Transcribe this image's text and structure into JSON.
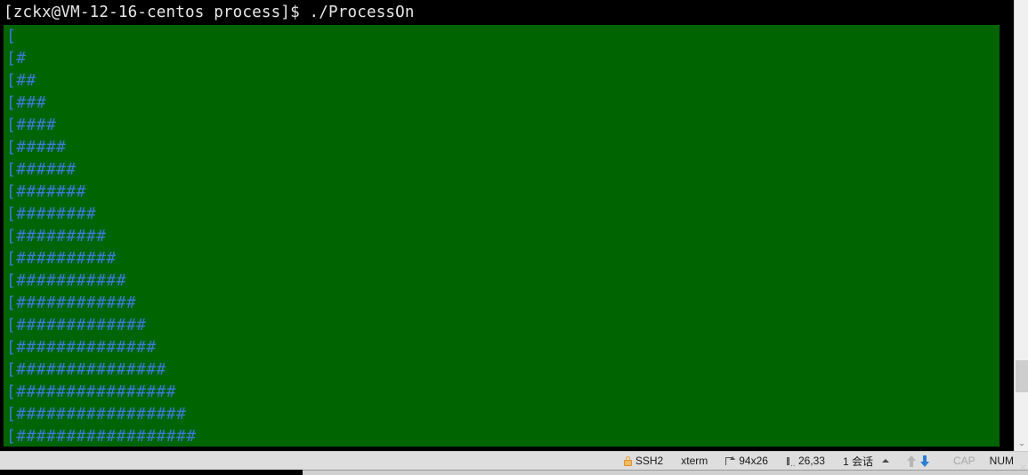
{
  "terminal": {
    "prompt_line": "[zckx@VM-12-16-centos process]$ ./ProcessOn",
    "background_color": "#006400",
    "text_color": "#3b7ad9",
    "prompt_background": "#000000",
    "prompt_text_color": "#e8e8e8",
    "output_lines": [
      "[",
      "[#",
      "[##",
      "[###",
      "[####",
      "[#####",
      "[######",
      "[#######",
      "[########",
      "[#########",
      "[##########",
      "[###########",
      "[############",
      "[#############",
      "[##############",
      "[###############",
      "[################",
      "[#################",
      "[##################"
    ]
  },
  "scrollbar": {
    "down_chevron": "⌄"
  },
  "status_bar": {
    "protocol": "SSH2",
    "emulation": "xterm",
    "size": "94x26",
    "cursor_position": "26,33",
    "sessions": "1 会话",
    "caps_lock": "CAP",
    "num_lock": "NUM",
    "lock_icon_color": "#f0bb62",
    "arrow_up_color": "#b5b5b5",
    "arrow_down_color": "#2a7fd4"
  }
}
